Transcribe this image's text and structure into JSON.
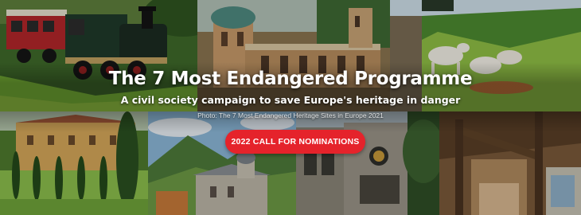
{
  "banner": {
    "title": "The 7 Most Endangered Programme",
    "subtitle": "A civil society campaign to save Europe's heritage in danger",
    "photo_credit": "Photo: The 7 Most Endangered Heritage Sites in Europe 2021",
    "cta_label": "2022 CALL FOR NOMINATIONS",
    "cta_color": "#e5232b"
  }
}
